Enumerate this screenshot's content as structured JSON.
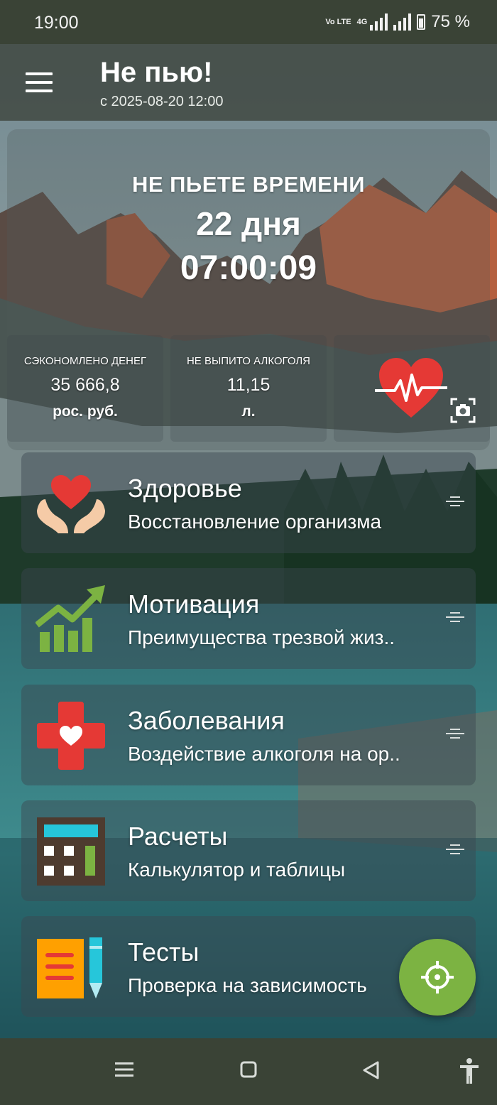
{
  "status_bar": {
    "time": "19:00",
    "network_badge": "Vo LTE",
    "network_type": "4G",
    "battery": "75 %"
  },
  "app_bar": {
    "title": "Не пью!",
    "subtitle": "с 2025-08-20 12:00"
  },
  "timer": {
    "label": "НЕ ПЬЕТЕ ВРЕМЕНИ",
    "days": "22 дня",
    "clock": "07:00:09"
  },
  "stats": [
    {
      "title": "СЭКОНОМЛЕНО ДЕНЕГ",
      "value": "35 666,8",
      "unit": "рос. руб."
    },
    {
      "title": "НЕ ВЫПИТО АЛКОГОЛЯ",
      "value": "11,15",
      "unit": "л."
    }
  ],
  "cards": [
    {
      "title": "Здоровье",
      "description": "Восстановление организма",
      "icon": "heart-hands-icon"
    },
    {
      "title": "Мотивация",
      "description": "Преимущества трезвой жиз..",
      "icon": "growth-chart-icon"
    },
    {
      "title": "Заболевания",
      "description": "Воздействие алкоголя на ор..",
      "icon": "medical-cross-icon"
    },
    {
      "title": "Расчеты",
      "description": "Калькулятор и таблицы",
      "icon": "calculator-icon"
    },
    {
      "title": "Тесты",
      "description": "Проверка на зависимость",
      "icon": "notepad-pencil-icon"
    }
  ],
  "colors": {
    "fab": "#7cb342",
    "heart_red": "#e53935",
    "chart_green": "#7cb342",
    "bars": "#3a4336"
  },
  "icons": {
    "fab": "crosshair-icon",
    "stats_extra": "heart-pulse-icon",
    "screenshot": "camera-icon",
    "nav": [
      "recents-icon",
      "home-icon",
      "back-icon",
      "accessibility-icon"
    ]
  }
}
